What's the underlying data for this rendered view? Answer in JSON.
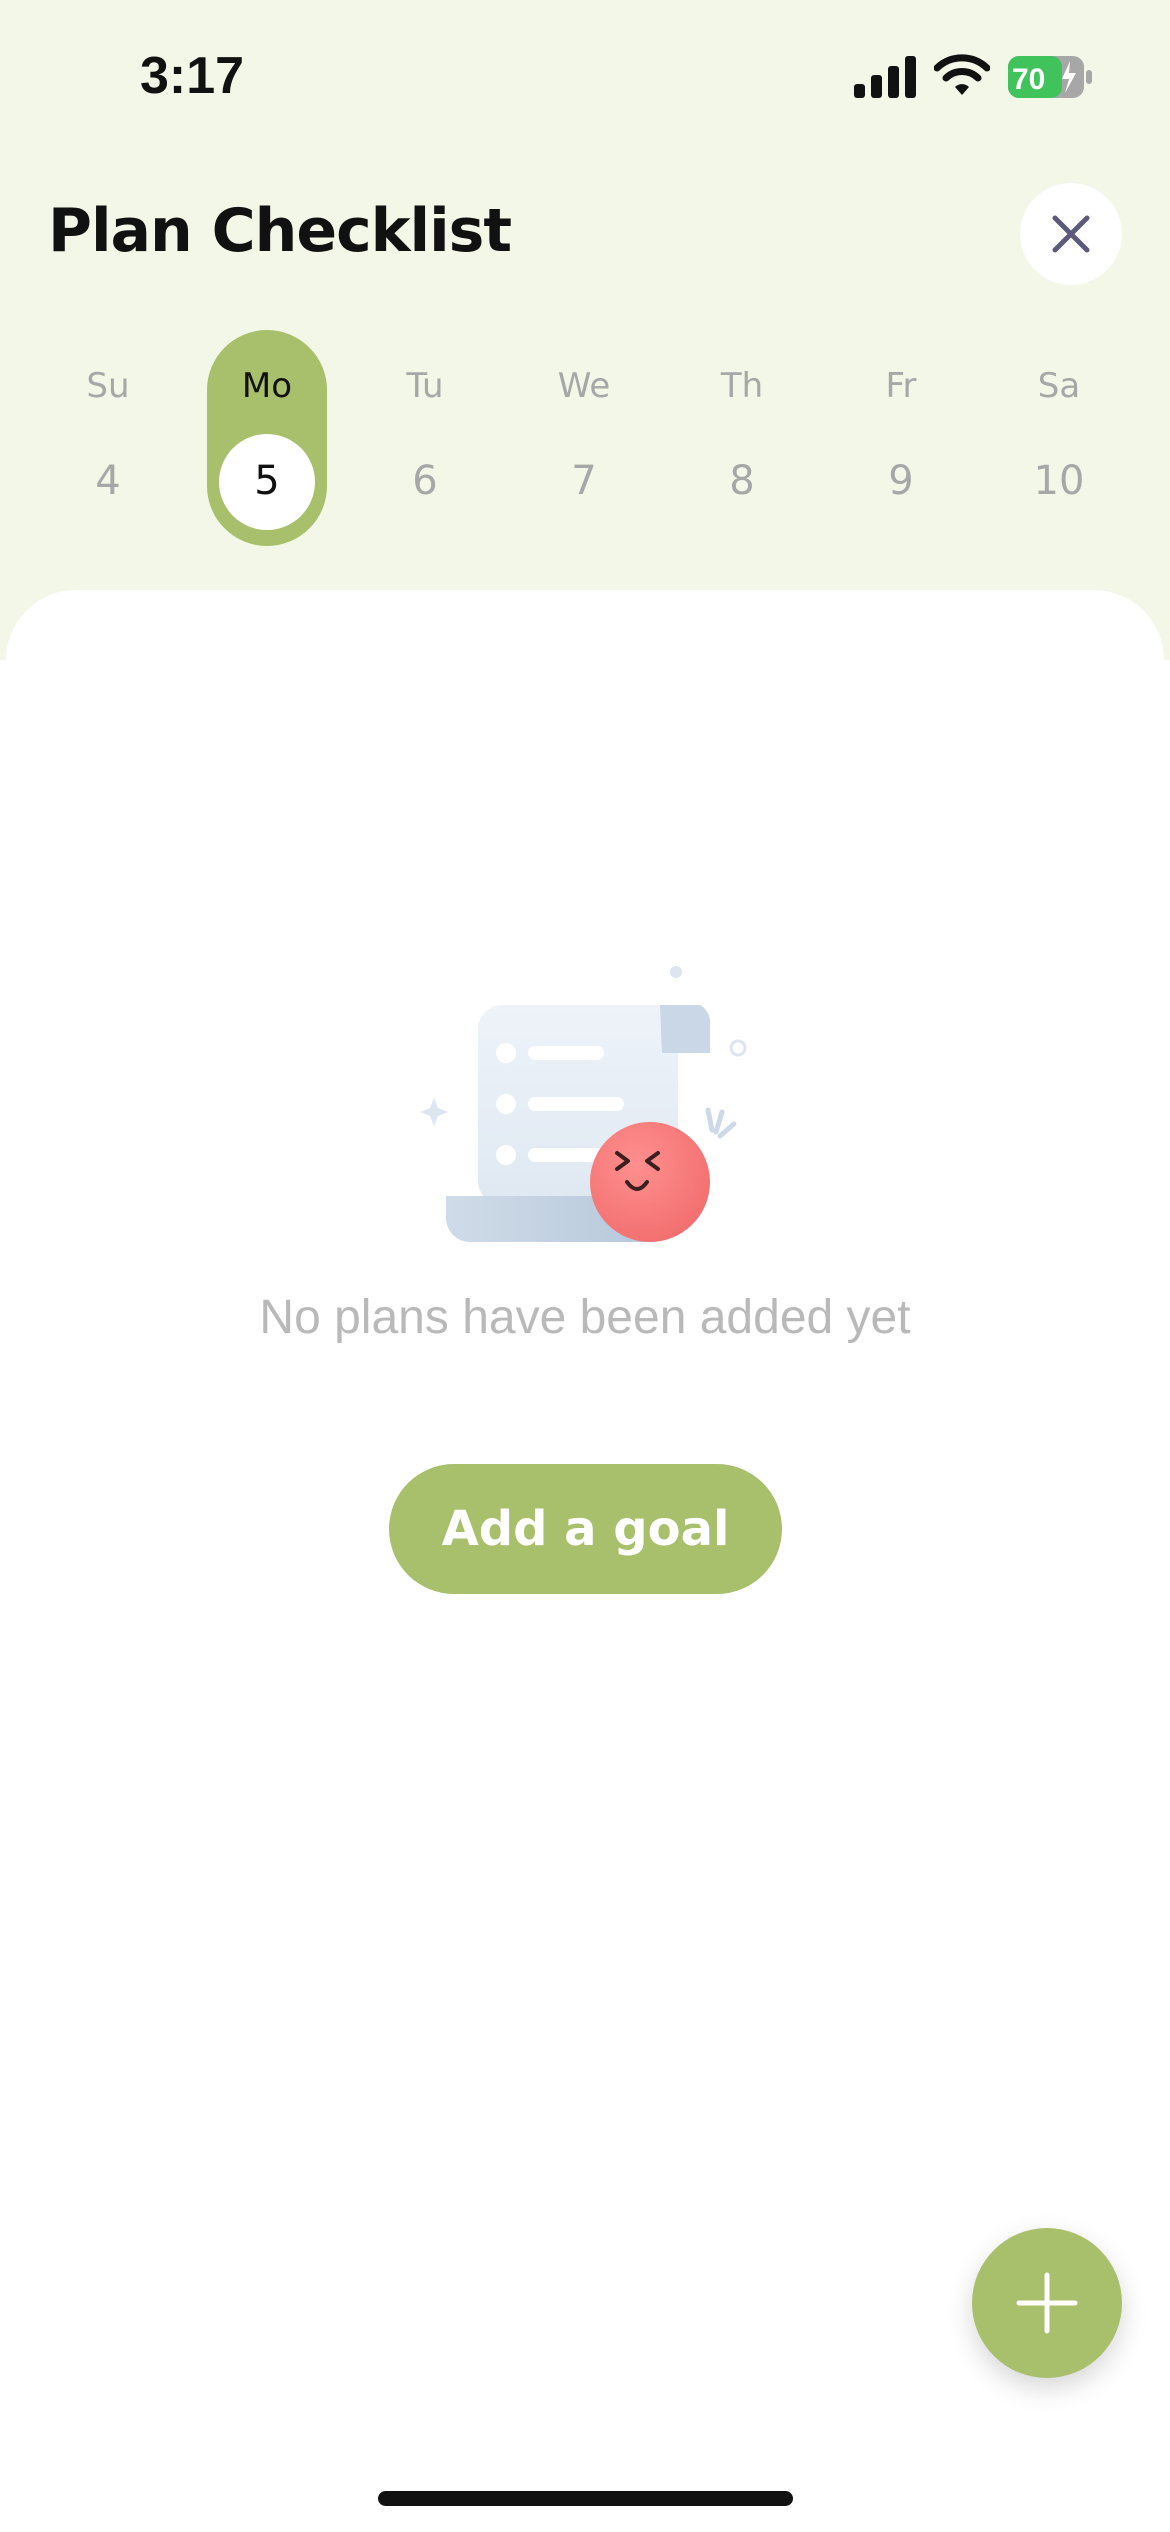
{
  "status_bar": {
    "time": "3:17",
    "battery_level": "70",
    "icons": [
      "signal-icon",
      "wifi-icon",
      "battery-charging-icon"
    ]
  },
  "header": {
    "title": "Plan Checklist",
    "close_icon": "close-icon"
  },
  "week": {
    "days": [
      {
        "name": "Su",
        "num": "4"
      },
      {
        "name": "Mo",
        "num": "5"
      },
      {
        "name": "Tu",
        "num": "6"
      },
      {
        "name": "We",
        "num": "7"
      },
      {
        "name": "Th",
        "num": "8"
      },
      {
        "name": "Fr",
        "num": "9"
      },
      {
        "name": "Sa",
        "num": "10"
      }
    ],
    "selected_index": 1
  },
  "empty_state": {
    "illustration_icon": "scroll-with-smiley-icon",
    "message": "No plans have been added yet",
    "button_label": "Add a goal"
  },
  "fab": {
    "icon": "plus-icon"
  },
  "colors": {
    "accent": "#a8bf6c",
    "top_background": "#f3f7e8",
    "muted_text": "#a7a7a7",
    "empty_text": "#b9b9b9",
    "battery_green": "#3fc35a"
  }
}
